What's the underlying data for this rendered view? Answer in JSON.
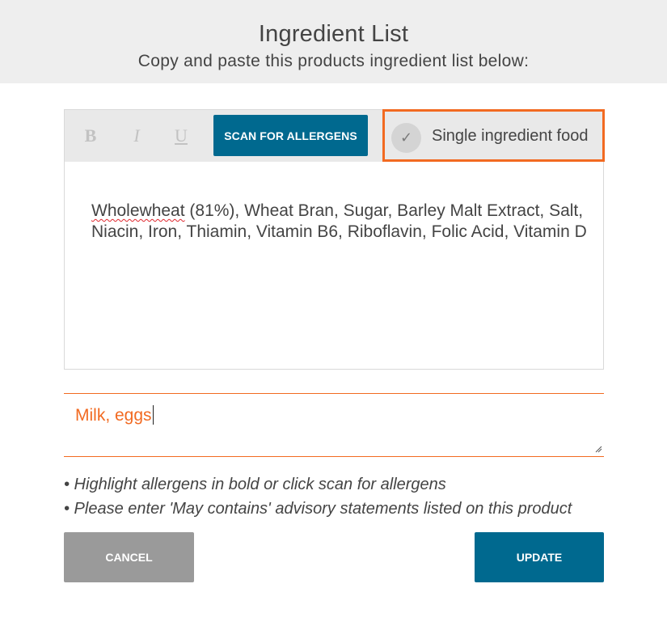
{
  "header": {
    "title": "Ingredient List",
    "subtitle": "Copy and paste this products ingredient list below:"
  },
  "toolbar": {
    "bold_glyph": "B",
    "italic_glyph": "I",
    "underline_glyph": "U",
    "scan_label": "SCAN FOR ALLERGENS",
    "single_ingredient": {
      "check_glyph": "✓",
      "label": "Single ingredient food"
    }
  },
  "editor": {
    "misspelled_word": "Wholewheat",
    "text_rest": " (81%), Wheat Bran, Sugar, Barley Malt Extract, Salt, Niacin, Iron, Thiamin, Vitamin B6, Riboflavin, Folic Acid, Vitamin D"
  },
  "allergens": {
    "value": "Milk, eggs"
  },
  "hints": [
    "• Highlight allergens in bold or click scan for allergens",
    "• Please enter 'May contains' advisory statements listed on this product"
  ],
  "buttons": {
    "cancel": "CANCEL",
    "update": "UPDATE"
  },
  "colors": {
    "accent_orange": "#f26a21",
    "primary_blue": "#00698f",
    "cancel_grey": "#9a9a9a",
    "header_bg": "#eeeeee",
    "toolbar_bg": "#e9e9e9"
  }
}
